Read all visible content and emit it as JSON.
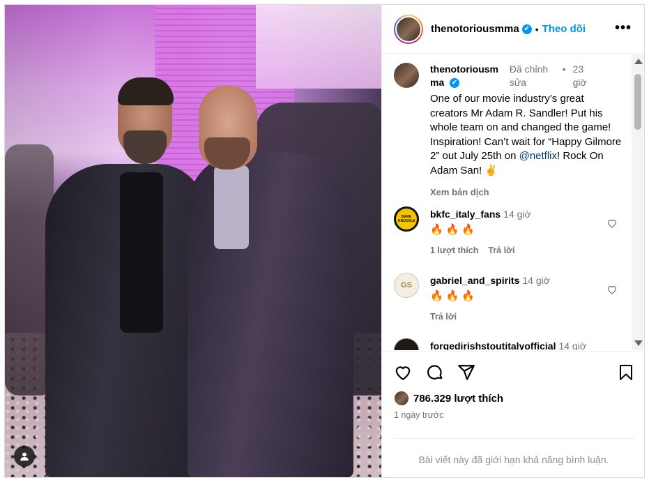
{
  "header": {
    "username": "thenotoriousmma",
    "verified_mark": "✔",
    "separator": "•",
    "follow_label": "Theo dõi",
    "more_label": "•••"
  },
  "caption": {
    "username": "thenotoriousmma",
    "verified_mark": "✔",
    "edited": "Đã chỉnh sửa",
    "separator": "•",
    "time": "23 giờ",
    "text_part1": "One of our movie industry’s great creators Mr Adam R. Sandler! Put his whole team on and changed the game! Inspiration! Can’t wait for “Happy Gilmore 2” out July 25th on ",
    "mention": "@netflix",
    "text_part2": "! Rock On Adam San! ✌️",
    "translate_label": "Xem bản dịch"
  },
  "comments": [
    {
      "username": "bkfc_italy_fans",
      "time": "14 giờ",
      "text": "🔥🔥🔥",
      "likes_label": "1 lượt thích",
      "reply_label": "Trả lời",
      "avatar_text": "BARE KNUCKLE"
    },
    {
      "username": "gabriel_and_spirits",
      "time": "14 giờ",
      "text": "🔥🔥🔥",
      "reply_label": "Trả lời",
      "avatar_text": "GS"
    },
    {
      "username": "forgedirishstoutitalyofficial",
      "time": "14 giờ",
      "avatar_text": ""
    }
  ],
  "footer": {
    "likes_count": "786.329 lượt thích",
    "time_ago": "1 ngày trước",
    "restricted_text": "Bài viết này đã giới hạn khả năng bình luận."
  },
  "icons": {
    "like": "heart-icon",
    "comment": "comment-icon",
    "share": "share-icon",
    "save": "bookmark-icon",
    "more": "more-icon",
    "user_tag": "user-icon"
  },
  "colors": {
    "accent": "#0095f6",
    "muted": "#737373",
    "mention": "#00376b"
  }
}
